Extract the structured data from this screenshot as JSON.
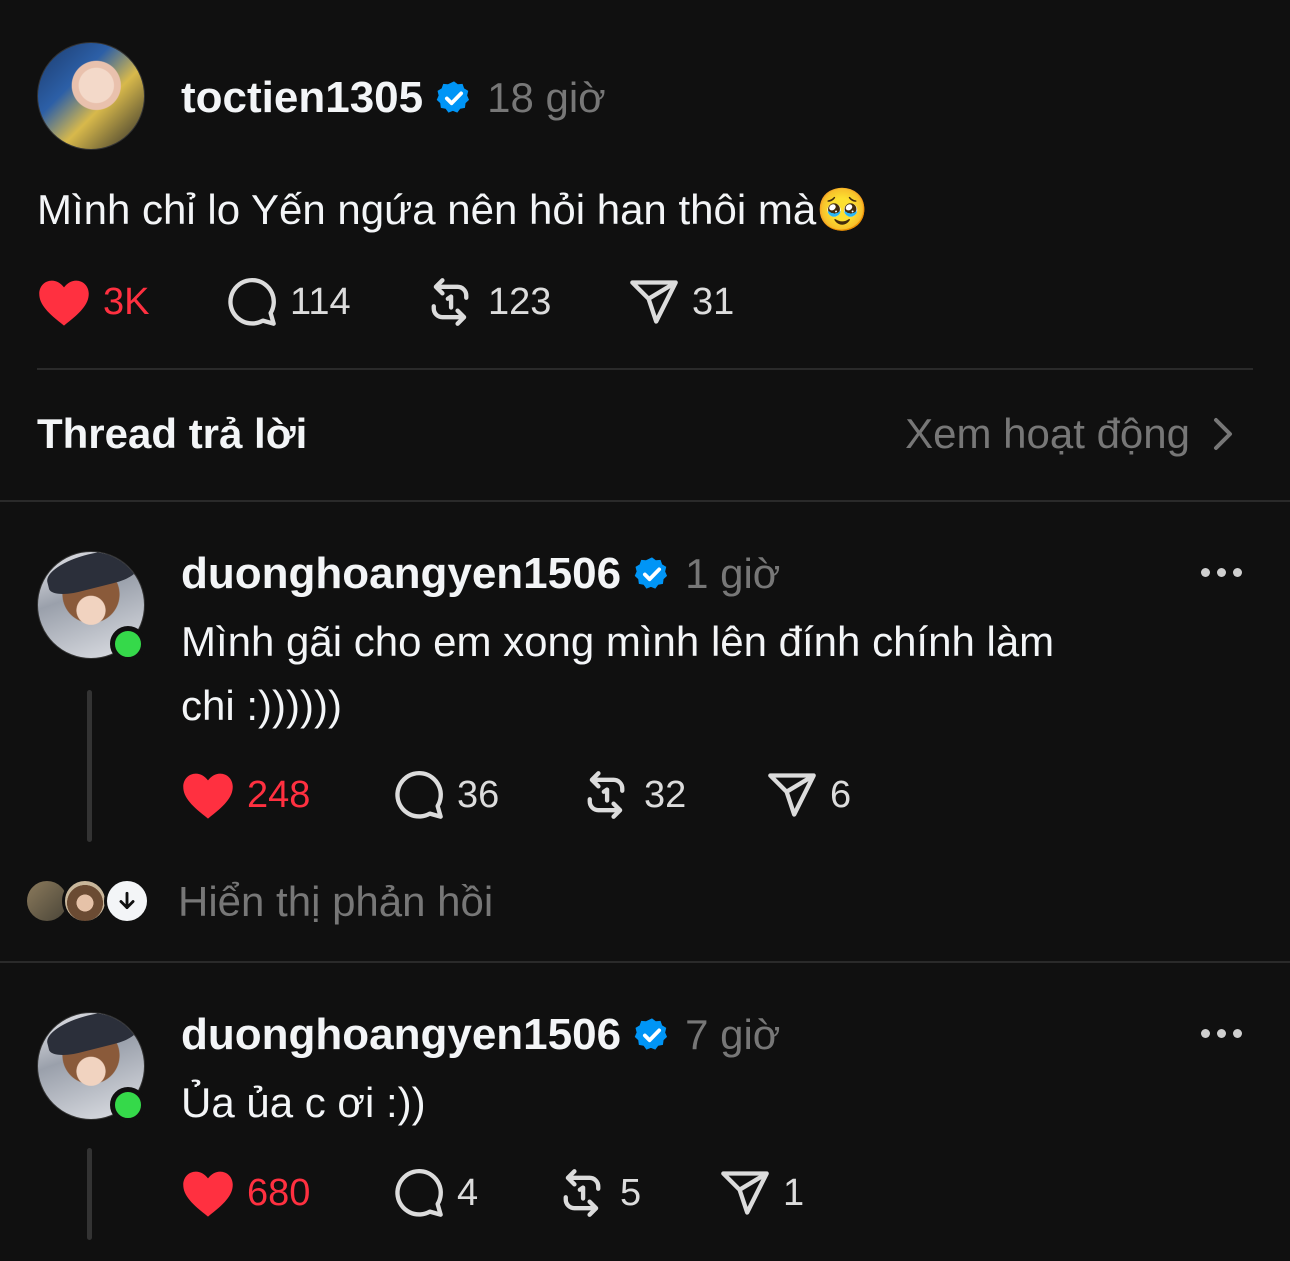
{
  "post": {
    "username": "toctien1305",
    "time": "18 giờ",
    "text": "Mình chỉ lo Yến ngứa nên hỏi han thôi mà",
    "emoji": "🥹",
    "likes": "3K",
    "comments": "114",
    "reposts": "123",
    "shares": "31",
    "liked": true
  },
  "replies_header": {
    "title": "Thread trả lời",
    "activity_link": "Xem hoạt động"
  },
  "replies": [
    {
      "username": "duonghoangyen1506",
      "time": "1 giờ",
      "text_line1": "Mình gãi cho em xong mình lên đính chính làm",
      "text_line2": "chi :))))))",
      "likes": "248",
      "comments": "36",
      "reposts": "32",
      "shares": "6",
      "online": true
    },
    {
      "username": "duonghoangyen1506",
      "time": "7 giờ",
      "text_line1": "Ủa ủa c ơi :))",
      "likes": "680",
      "comments": "4",
      "reposts": "5",
      "shares": "1",
      "online": true
    }
  ],
  "show_replies": {
    "label": "Hiển thị phản hồi"
  },
  "colors": {
    "background": "#101010",
    "like_red": "#ff3040",
    "verified_blue": "#0095f6",
    "online_green": "#35d94a",
    "muted_text": "#777777"
  },
  "icons": [
    "heart-icon",
    "comment-icon",
    "repost-icon",
    "share-icon",
    "verified-icon",
    "more-icon",
    "chevron-right-icon",
    "arrow-down-icon"
  ]
}
